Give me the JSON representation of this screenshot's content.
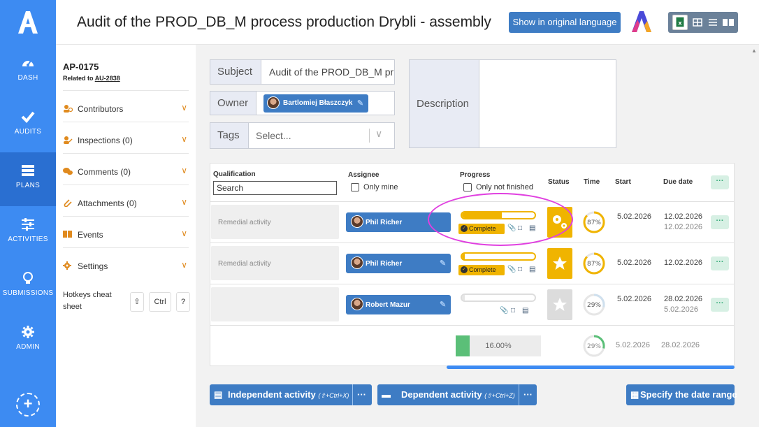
{
  "nav": {
    "items": [
      {
        "label": "DASH",
        "icon": "gauge-icon"
      },
      {
        "label": "AUDITS",
        "icon": "check-icon"
      },
      {
        "label": "PLANS",
        "icon": "layers-icon"
      },
      {
        "label": "ACTIVITIES",
        "icon": "sliders-icon"
      },
      {
        "label": "SUBMISSIONS",
        "icon": "lightbulb-icon"
      },
      {
        "label": "ADMIN",
        "icon": "gear-icon"
      }
    ],
    "active": "PLANS",
    "add_symbol": "+"
  },
  "header": {
    "title": "Audit of the PROD_DB_M process production Drybli - assembly",
    "original_language_button": "Show in original language"
  },
  "sidebar": {
    "code": "AP-0175",
    "related_prefix": "Related to",
    "related_link": "AU-2838",
    "items": [
      {
        "label": "Contributors",
        "icon": "users-icon"
      },
      {
        "label": "Inspections (0)",
        "icon": "inspector-icon"
      },
      {
        "label": "Comments (0)",
        "icon": "comments-icon"
      },
      {
        "label": "Attachments (0)",
        "icon": "paperclip-icon"
      },
      {
        "label": "Events",
        "icon": "book-icon"
      },
      {
        "label": "Settings",
        "icon": "gear-icon"
      }
    ],
    "hotkeys_label": "Hotkeys cheat sheet",
    "keys": [
      "⇧",
      "Ctrl",
      "?"
    ]
  },
  "form": {
    "subject_label": "Subject",
    "subject_value": "Audit of the PROD_DB_M process production Drybli - assembly",
    "owner_label": "Owner",
    "owner_name": "Bartlomiej Błaszczyk",
    "tags_label": "Tags",
    "tags_placeholder": "Select...",
    "description_label": "Description"
  },
  "table": {
    "headers": {
      "qualification": "Qualification",
      "assignee": "Assignee",
      "progress": "Progress",
      "status": "Status",
      "time": "Time",
      "start": "Start",
      "due": "Due date"
    },
    "search_placeholder": "Search",
    "only_mine": "Only mine",
    "only_not_finished": "Only not finished",
    "more": "···",
    "rows": [
      {
        "qualification": "Remedial activity",
        "assignee": "Phil Richer",
        "progress": 0.55,
        "complete_label": "Complete",
        "status": "in-progress",
        "time": "87%",
        "time_value": 0.87,
        "start": "5.02.2026",
        "due": "12.02.2026",
        "due_sub": "12.02.2026"
      },
      {
        "qualification": "Remedial activity",
        "assignee": "Phil Richer",
        "progress": 0.04,
        "complete_label": "Complete",
        "status": "starred",
        "time": "87%",
        "time_value": 0.87,
        "start": "5.02.2026",
        "due": "12.02.2026",
        "due_sub": ""
      },
      {
        "qualification": "",
        "assignee": "Robert Mazur",
        "progress": 0.04,
        "complete_label": "",
        "status": "none",
        "time": "29%",
        "time_value": 0.29,
        "start": "5.02.2026",
        "due": "28.02.2026",
        "due_sub": "5.02.2026"
      }
    ],
    "summary": {
      "progress": "16.00%",
      "progress_value": 0.16,
      "time": "29%",
      "time_value": 0.29,
      "start": "5.02.2026",
      "due": "28.02.2026"
    }
  },
  "actions": {
    "independent": "Independent activity",
    "independent_hotkey": "(⇧+Ctrl+X)",
    "dependent": "Dependent activity",
    "dependent_hotkey": "(⇧+Ctrl+Z)",
    "date_range": "Specify the date range",
    "more": "···"
  },
  "colors": {
    "nav": "#3d8bf2",
    "nav_active": "#2a6fd1",
    "button": "#3e7cc4",
    "progress": "#f0b400",
    "annotation": "#e040e0"
  }
}
